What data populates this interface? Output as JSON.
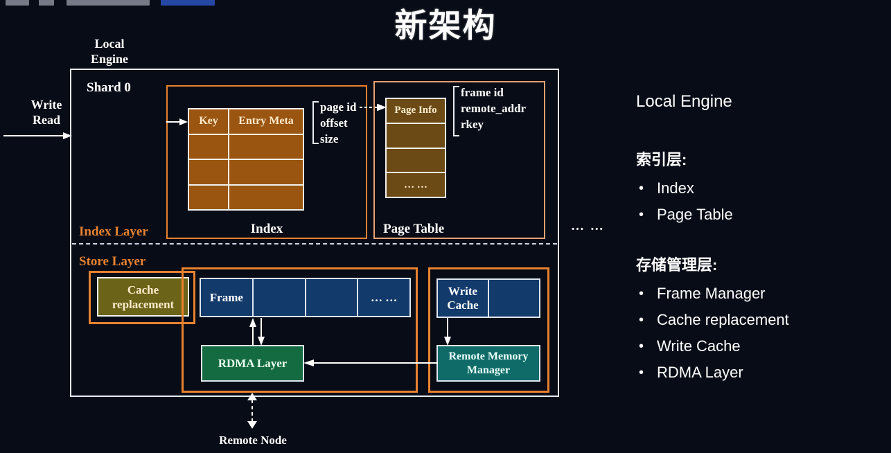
{
  "title": "新架构",
  "flow": {
    "write": "Write",
    "read": "Read"
  },
  "engine": {
    "caption_line1": "Local",
    "caption_line2": "Engine",
    "shard": "Shard 0",
    "index_layer_label": "Index Layer",
    "store_layer_label": "Store Layer",
    "shard_ellipsis": "… …"
  },
  "index_group": {
    "caption": "Index",
    "columns": [
      "Key",
      "Entry Meta"
    ],
    "empty_rows": 3,
    "entry_meta_fields": [
      "page id",
      "offset",
      "size"
    ]
  },
  "page_table_group": {
    "caption": "Page Table",
    "header": "Page Info",
    "rows": [
      "",
      "",
      "… …"
    ],
    "page_info_fields": [
      "frame id",
      "remote_addr",
      "rkey"
    ]
  },
  "store": {
    "cache_replacement": "Cache\nreplacement",
    "cache_replacement_l1": "Cache",
    "cache_replacement_l2": "replacement",
    "frame_cells": [
      "Frame",
      "",
      "",
      "… …"
    ],
    "rdma_layer": "RDMA Layer",
    "write_cache_l1": "Write",
    "write_cache_l2": "Cache",
    "write_cache_cells": [
      "",
      ""
    ],
    "remote_memory_manager_l1": "Remote Memory",
    "remote_memory_manager_l2": "Manager"
  },
  "remote_node": "Remote Node",
  "legend": {
    "heading": "Local Engine",
    "section1_title": "索引层:",
    "section1_items": [
      "Index",
      "Page Table"
    ],
    "section2_title": "存储管理层:",
    "section2_items": [
      "Frame Manager",
      "Cache replacement",
      "Write Cache",
      "RDMA Layer"
    ]
  },
  "colors": {
    "background": "#080c16",
    "accent_orange": "#e8822f",
    "index_cell": "#9a5511",
    "page_table_cell": "#6b4a16",
    "frame_cell": "#123a6b",
    "cache_replacement": "#6b6318",
    "rdma_layer": "#156b41",
    "remote_memory_manager": "#0f6b68",
    "outline": "#e7ecf5"
  }
}
